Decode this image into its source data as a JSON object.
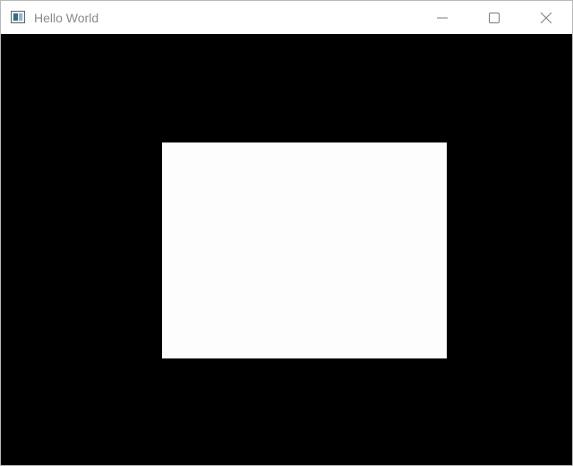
{
  "window": {
    "title": "Hello World",
    "title_color": "#8a8a8a",
    "background": "#000000",
    "titlebar_background": "#ffffff"
  },
  "icons": {
    "app": "app-window-icon",
    "minimize": "minimize-icon",
    "maximize": "maximize-icon",
    "close": "close-icon"
  },
  "canvas": {
    "shape": "rectangle",
    "fill": "#fdfdfd"
  }
}
